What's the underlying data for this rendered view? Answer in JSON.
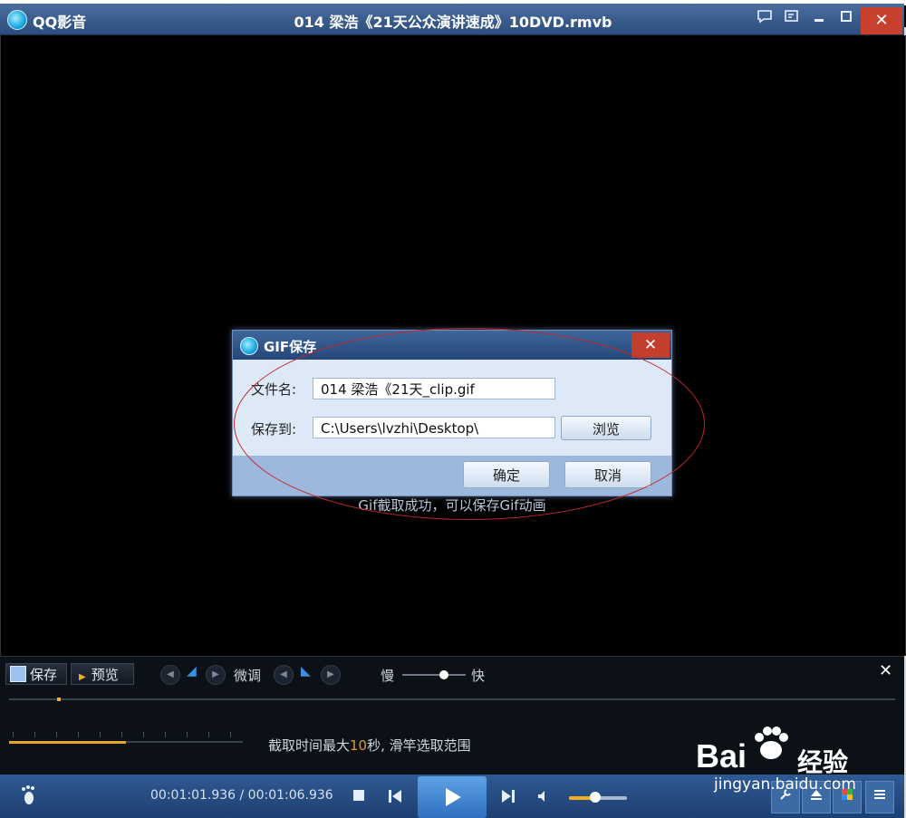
{
  "window": {
    "app_name": "QQ影音",
    "title": "014 梁浩《21天公众演讲速成》10DVD.rmvb"
  },
  "title_icons": {
    "chat": "speech-bubble-icon",
    "playlist": "playlist-icon",
    "minimize": "minimize-icon",
    "maximize": "maximize-icon",
    "close": "close-icon",
    "close_glyph": "✕"
  },
  "dialog": {
    "title": "GIF保存",
    "filename_label": "文件名:",
    "filename_value": "014 梁浩《21天_clip.gif",
    "saveto_label": "保存到:",
    "saveto_value": "C:\\Users\\lvzhi\\Desktop\\",
    "browse_label": "浏览",
    "ok_label": "确定",
    "cancel_label": "取消",
    "close_glyph": "✕"
  },
  "gif_message": "Gif截取成功，可以保存Gif动画",
  "gif_panel": {
    "save_label": "保存",
    "preview_label": "预览",
    "finetune_label": "微调",
    "slow_label": "慢",
    "fast_label": "快",
    "hint_before": "截取时间最大",
    "hint_number": "10",
    "hint_after": "秒, 滑竿选取范围",
    "close_glyph": "✕",
    "speed_level": 0.65,
    "range_fill": 0.5
  },
  "controlbar": {
    "time": "00:01:01.936 / 00:01:06.936",
    "volume": 0.45
  },
  "watermark": {
    "brand_left": "Bai",
    "brand_right": "经验",
    "url": "jingyan.baidu.com"
  },
  "colors": {
    "titlebar": "#2c4d7c",
    "close_red": "#c8402e",
    "accent_orange": "#e4a52a",
    "annotation_red": "#c0282a"
  }
}
